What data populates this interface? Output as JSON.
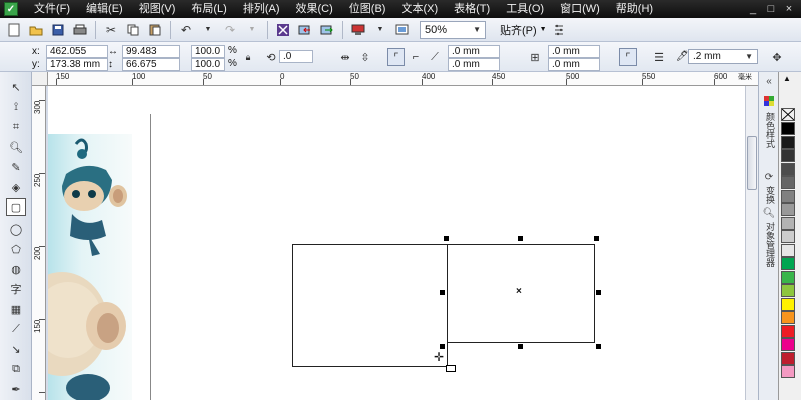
{
  "menu": {
    "items": [
      "文件(F)",
      "编辑(E)",
      "视图(V)",
      "布局(L)",
      "排列(A)",
      "效果(C)",
      "位图(B)",
      "文本(X)",
      "表格(T)",
      "工具(O)",
      "窗口(W)",
      "帮助(H)"
    ],
    "window_controls": [
      "_",
      "□",
      "×"
    ]
  },
  "toolbar": {
    "zoom_value": "50%",
    "snap_label": "贴齐(P)"
  },
  "properties": {
    "x_label": "x:",
    "x_value": "462.055 mm",
    "y_label": "y:",
    "y_value": "173.38 mm",
    "width_value": "99.483 mm",
    "height_value": "66.675 mm",
    "scale_x": "100.0",
    "scale_y": "100.0",
    "percent": "%",
    "rotation": ".0",
    "corner_tl": ".0 mm",
    "corner_bl": ".0 mm",
    "corner_tr": ".0 mm",
    "corner_br": ".0 mm",
    "outline_width": ".2 mm"
  },
  "ruler": {
    "top_labels": [
      "150",
      "100",
      "50",
      "0",
      "50",
      "100",
      "150",
      "200",
      "250",
      "300",
      "350",
      "400",
      "450",
      "500",
      "550",
      "600",
      "650",
      "700"
    ],
    "left_labels": [
      "300",
      "250",
      "200",
      "150",
      "100"
    ],
    "unit": "毫米"
  },
  "toolbox": {
    "text_tool": "字"
  },
  "docker": {
    "tab1": "颜色样式",
    "tab2": "变换",
    "tab3": "对象管理器"
  },
  "palette": {
    "colors": [
      "#ffffff",
      "#000000",
      "#1a1a1a",
      "#333333",
      "#4d4d4d",
      "#666666",
      "#808080",
      "#999999",
      "#b3b3b3",
      "#cccccc",
      "#e6e6e6",
      "#00a651",
      "#39b54a",
      "#8dc63f",
      "#fff200",
      "#f7941d",
      "#ed1c24",
      "#ec008c",
      "#be1e2d",
      "#f49ac2"
    ]
  },
  "canvas": {
    "center_marker": "×"
  }
}
